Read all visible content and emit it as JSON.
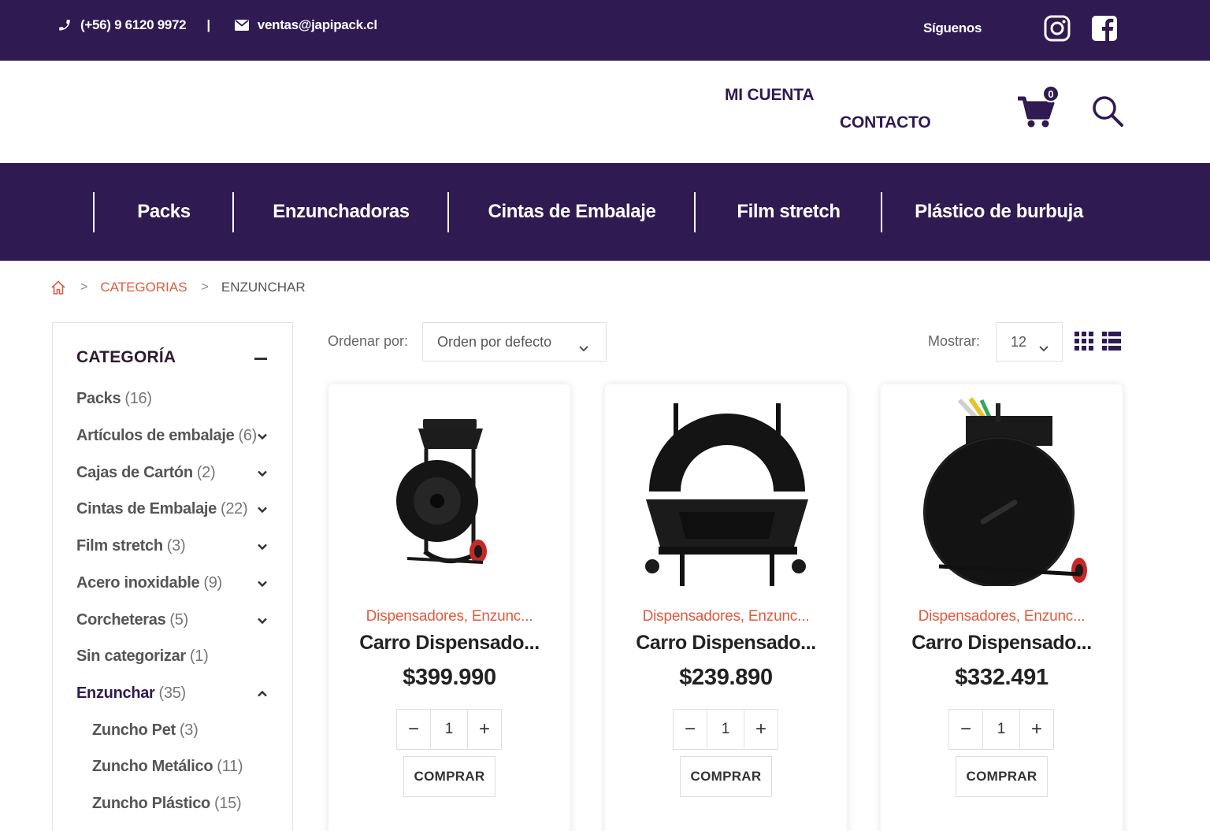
{
  "topbar": {
    "phone": "(+56) 9 6120 9972",
    "separator": "|",
    "email": "ventas@japipack.cl",
    "follow_label": "Síguenos",
    "social": [
      "instagram-icon",
      "facebook-icon"
    ]
  },
  "header": {
    "account_link": "MI CUENTA",
    "contact_link": "CONTACTO",
    "cart_count": "0"
  },
  "nav": {
    "items": [
      "Packs",
      "Enzunchadoras",
      "Cintas de Embalaje",
      "Film stretch",
      "Plástico de burbuja"
    ]
  },
  "breadcrumb": {
    "separator": ">",
    "link": "CATEGORIAS",
    "current": "ENZUNCHAR"
  },
  "sidebar": {
    "title": "CATEGORÍA",
    "categories": [
      {
        "name": "Packs",
        "count": "(16)"
      },
      {
        "name": "Artículos de embalaje",
        "count": "(6)"
      },
      {
        "name": "Cajas de Cartón",
        "count": "(2)"
      },
      {
        "name": "Cintas de Embalaje",
        "count": "(22)"
      },
      {
        "name": "Film stretch",
        "count": "(3)"
      },
      {
        "name": "Acero inoxidable",
        "count": "(9)"
      },
      {
        "name": "Corcheteras",
        "count": "(5)"
      },
      {
        "name": "Sin categorizar",
        "count": "(1)"
      },
      {
        "name": "Enzunchar",
        "count": "(35)"
      },
      {
        "name": "Zuncho Pet",
        "count": "(3)"
      },
      {
        "name": "Zuncho Metálico",
        "count": "(11)"
      },
      {
        "name": "Zuncho Plástico",
        "count": "(15)"
      }
    ]
  },
  "toolbar": {
    "sort_label": "Ordenar por:",
    "sort_value": "Orden por defecto",
    "show_label": "Mostrar:",
    "show_value": "12"
  },
  "products": [
    {
      "categories": "Dispensadores, Enzunc...",
      "name": "Carro Dispensado...",
      "price": "$399.990",
      "qty": "1",
      "buy": "COMPRAR"
    },
    {
      "categories": "Dispensadores, Enzunc...",
      "name": "Carro Dispensado...",
      "price": "$239.890",
      "qty": "1",
      "buy": "COMPRAR"
    },
    {
      "categories": "Dispensadores, Enzunc...",
      "name": "Carro Dispensado...",
      "price": "$332.491",
      "qty": "1",
      "buy": "COMPRAR"
    }
  ],
  "qty_controls": {
    "minus": "−",
    "plus": "+"
  },
  "colors": {
    "brand": "#2f1a52",
    "accent": "#e15a3c",
    "cart_wheel": "#c62828"
  }
}
